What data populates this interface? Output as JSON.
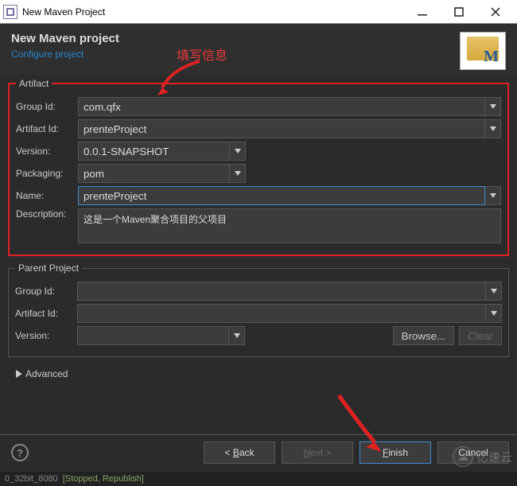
{
  "window": {
    "title": "New Maven Project"
  },
  "heading": {
    "title": "New Maven project",
    "configure": "Configure project"
  },
  "annotation": {
    "fill_info": "填写信息"
  },
  "artifact": {
    "legend": "Artifact",
    "group_id_label": "Group Id:",
    "group_id": "com.qfx",
    "artifact_id_label": "Artifact Id:",
    "artifact_id": "prenteProject",
    "version_label": "Version:",
    "version": "0.0.1-SNAPSHOT",
    "packaging_label": "Packaging:",
    "packaging": "pom",
    "name_label": "Name:",
    "name": "prenteProject",
    "description_label": "Description:",
    "description": "这是一个Maven聚合项目的父项目"
  },
  "parent": {
    "legend": "Parent Project",
    "group_id_label": "Group Id:",
    "group_id": "",
    "artifact_id_label": "Artifact Id:",
    "artifact_id": "",
    "version_label": "Version:",
    "version": "",
    "browse": "Browse...",
    "clear": "Clear"
  },
  "advanced": {
    "label": "Advanced"
  },
  "buttons": {
    "back_prefix": "< ",
    "back_u": "B",
    "back_suffix": "ack",
    "next_prefix": "",
    "next_u": "N",
    "next_suffix": "ext >",
    "finish_prefix": "",
    "finish_u": "F",
    "finish_suffix": "inish",
    "cancel": "Cancel"
  },
  "status": {
    "gray": "0_32bit_8080",
    "green": "[Stopped, Republish]"
  },
  "watermark": {
    "text": "亿速云"
  }
}
